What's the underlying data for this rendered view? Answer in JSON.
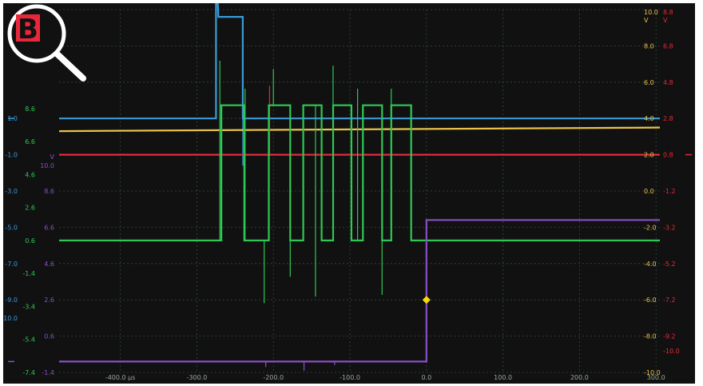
{
  "badge": {
    "letter": "B",
    "color": "#e8202a",
    "icon": "magnifier-icon"
  },
  "colors": {
    "background": "#111111",
    "grid": "#2e4a3e",
    "blue": "#3a9ad9",
    "yellow": "#e8c24a",
    "red": "#e8283a",
    "green": "#2ec954",
    "purple": "#8a4fc8",
    "trigger": "#f5d90a"
  },
  "chart_data": {
    "type": "line",
    "xlim": [
      -480,
      305
    ],
    "ylim": [
      -10,
      10
    ],
    "grid": true,
    "x_ticks": [
      {
        "v": -400,
        "label": "-400.0 µs"
      },
      {
        "v": -300,
        "label": "-300.0"
      },
      {
        "v": -200,
        "label": "-200.0"
      },
      {
        "v": -100,
        "label": "-100.0"
      },
      {
        "v": 0,
        "label": "0.0"
      },
      {
        "v": 100,
        "label": "100.0"
      },
      {
        "v": 200,
        "label": "200.0"
      },
      {
        "v": 300,
        "label": "300.0"
      }
    ],
    "axes": [
      {
        "name": "yellow-axis",
        "color": "yellow",
        "side": "right",
        "col": 0,
        "unit": "V",
        "top": 10,
        "bottom": -10,
        "ticks": [
          [
            10,
            "10.0"
          ],
          [
            8,
            "8.0"
          ],
          [
            6,
            "6.0"
          ],
          [
            4,
            "4.0"
          ],
          [
            2,
            "2.0"
          ],
          [
            0,
            "0.0"
          ],
          [
            -2,
            "-2.0"
          ],
          [
            -4,
            "-4.0"
          ],
          [
            -6,
            "-6.0"
          ],
          [
            -8,
            "-8.0"
          ],
          [
            -10,
            "-10.0"
          ]
        ]
      },
      {
        "name": "red-axis",
        "color": "red",
        "side": "right",
        "col": 1,
        "unit": "V",
        "top": 8.8,
        "bottom": -11.2,
        "ticks": [
          [
            8.8,
            "8.8"
          ],
          [
            6.8,
            "6.8"
          ],
          [
            4.8,
            "4.8"
          ],
          [
            2.8,
            "2.8"
          ],
          [
            0.8,
            "0.8"
          ],
          [
            -1.2,
            "-1.2"
          ],
          [
            -3.2,
            "-3.2"
          ],
          [
            -5.2,
            "-5.2"
          ],
          [
            -7.2,
            "-7.2"
          ],
          [
            -9.2,
            "-9.2"
          ],
          [
            -10,
            "-10.0"
          ]
        ]
      },
      {
        "name": "blue-axis",
        "color": "blue",
        "side": "left",
        "col": 0,
        "unit": "",
        "top": 7,
        "bottom": -13,
        "ticks": [
          [
            1,
            "1.0"
          ],
          [
            -1,
            "-1.0"
          ],
          [
            -3,
            "-3.0"
          ],
          [
            -5,
            "-5.0"
          ],
          [
            -7,
            "-7.0"
          ],
          [
            -9,
            "-9.0"
          ],
          [
            -10,
            "-10.0"
          ]
        ]
      },
      {
        "name": "green-axis",
        "color": "green",
        "side": "left",
        "col": 1,
        "unit": "",
        "top": 14.6,
        "bottom": -7.4,
        "ticks": [
          [
            8.6,
            "8.6"
          ],
          [
            6.6,
            "6.6"
          ],
          [
            4.6,
            "4.6"
          ],
          [
            2.6,
            "2.6"
          ],
          [
            0.6,
            "0.6"
          ],
          [
            -1.4,
            "-1.4"
          ],
          [
            -3.4,
            "-3.4"
          ],
          [
            -5.4,
            "-5.4"
          ],
          [
            -7.4,
            "-7.4"
          ]
        ]
      },
      {
        "name": "purple-axis",
        "color": "purple",
        "side": "left",
        "col": 2,
        "unit": "V",
        "top": 18.6,
        "bottom": -1.4,
        "ticks": [
          [
            10,
            "10.0"
          ],
          [
            8.6,
            "8.6"
          ],
          [
            6.6,
            "6.6"
          ],
          [
            4.6,
            "4.6"
          ],
          [
            2.6,
            "2.6"
          ],
          [
            0.6,
            "0.6"
          ],
          [
            -1.4,
            "-1.4"
          ]
        ]
      }
    ],
    "series": [
      {
        "color": "blue",
        "axis": "blue-axis",
        "points": [
          [
            -480,
            1
          ],
          [
            -275,
            1
          ],
          [
            -275,
            10
          ],
          [
            -272,
            6.6
          ],
          [
            -240,
            6.6
          ],
          [
            -240,
            1
          ],
          [
            305,
            1
          ]
        ],
        "spikes": [
          [
            -275,
            10
          ],
          [
            -240,
            -1.6
          ]
        ]
      },
      {
        "color": "yellow",
        "axis": "yellow-axis",
        "points": [
          [
            -480,
            3.3
          ],
          [
            305,
            3.5
          ]
        ],
        "spikes": []
      },
      {
        "color": "red",
        "axis": "red-axis",
        "points": [
          [
            -480,
            0.8
          ],
          [
            305,
            0.8
          ]
        ],
        "spikes": [
          [
            -205,
            4.6
          ]
        ]
      },
      {
        "color": "green",
        "axis": "green-axis",
        "points": [
          [
            -480,
            0.6
          ],
          [
            -268,
            0.6
          ],
          [
            -268,
            8.8
          ],
          [
            -238,
            8.8
          ],
          [
            -238,
            0.6
          ],
          [
            -206,
            0.6
          ],
          [
            -206,
            8.8
          ],
          [
            -178,
            8.8
          ],
          [
            -178,
            0.6
          ],
          [
            -161,
            0.6
          ],
          [
            -161,
            8.8
          ],
          [
            -137,
            8.8
          ],
          [
            -137,
            0.6
          ],
          [
            -122,
            0.6
          ],
          [
            -122,
            8.8
          ],
          [
            -98,
            8.8
          ],
          [
            -98,
            0.6
          ],
          [
            -83,
            0.6
          ],
          [
            -83,
            8.8
          ],
          [
            -58,
            8.8
          ],
          [
            -58,
            0.6
          ],
          [
            -46,
            0.6
          ],
          [
            -46,
            8.8
          ],
          [
            -20,
            8.8
          ],
          [
            -20,
            0.6
          ],
          [
            305,
            0.6
          ]
        ],
        "spikes": [
          [
            -270,
            11.5
          ],
          [
            -237,
            9.8
          ],
          [
            -212,
            -3.2
          ],
          [
            -200,
            11.0
          ],
          [
            -178,
            -1.6
          ],
          [
            -145,
            -2.8
          ],
          [
            -122,
            11.2
          ],
          [
            -90,
            9.8
          ],
          [
            -58,
            -2.7
          ],
          [
            -46,
            9.8
          ]
        ]
      },
      {
        "color": "purple",
        "axis": "purple-axis",
        "points": [
          [
            -480,
            -0.8
          ],
          [
            0,
            -0.8
          ],
          [
            0,
            7
          ],
          [
            305,
            7
          ]
        ],
        "spikes": [
          [
            -210,
            -1.1
          ],
          [
            -160,
            -1.3
          ],
          [
            -120,
            -1.0
          ]
        ]
      }
    ],
    "trigger": {
      "x": 0,
      "y": 2.6,
      "axis": "purple-axis"
    },
    "markers": [
      {
        "axis": "blue-axis",
        "side": "left",
        "y": 1
      },
      {
        "axis": "purple-axis",
        "side": "left",
        "y": -0.8
      },
      {
        "axis": "red-axis",
        "side": "right",
        "y": 0.8
      }
    ]
  }
}
